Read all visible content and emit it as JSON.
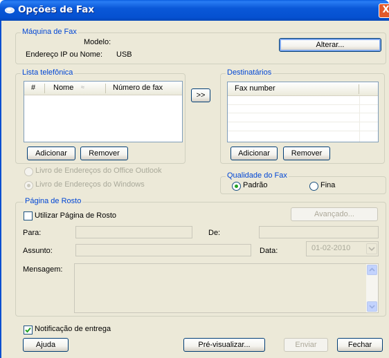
{
  "window": {
    "title": "Opções de Fax",
    "close_glyph": "X"
  },
  "machine": {
    "legend": "Máquina de Fax",
    "model_label": "Modelo:",
    "model_value": "",
    "address_label": "Endereço IP ou Nome:",
    "address_value": "USB",
    "change_button": "Alterar..."
  },
  "phonebook": {
    "legend": "Lista telefônica",
    "columns": [
      "#",
      "Nome",
      "Número de fax"
    ],
    "sort_glyph": "≈",
    "add_button": "Adicionar",
    "remove_button": "Remover",
    "source_outlook": "Livro de Endereços do Office Outlook",
    "source_windows": "Livro de Endereços do Windows"
  },
  "transfer_button": ">>",
  "recipients": {
    "legend": "Destinatários",
    "column": "Fax number",
    "add_button": "Adicionar",
    "remove_button": "Remover"
  },
  "quality": {
    "legend": "Qualidade do Fax",
    "standard": "Padrão",
    "fine": "Fina",
    "selected": "standard"
  },
  "cover": {
    "legend": "Página de Rosto",
    "use_label": "Utilizar Página de Rosto",
    "use_checked": false,
    "advanced_button": "Avançado...",
    "to_label": "Para:",
    "from_label": "De:",
    "subject_label": "Assunto:",
    "date_label": "Data:",
    "date_value": "01-02-2010",
    "message_label": "Mensagem:"
  },
  "delivery": {
    "label": "Notificação de entrega",
    "checked": true
  },
  "footer": {
    "help_button": "Ajuda",
    "preview_button": "Pré-visualizar...",
    "send_button": "Enviar",
    "close_button": "Fechar"
  },
  "colors": {
    "title_bar": "#0a58d8",
    "dialog_bg": "#ece9d8",
    "legend_text": "#0046d5",
    "radio_dot": "#21a121"
  }
}
